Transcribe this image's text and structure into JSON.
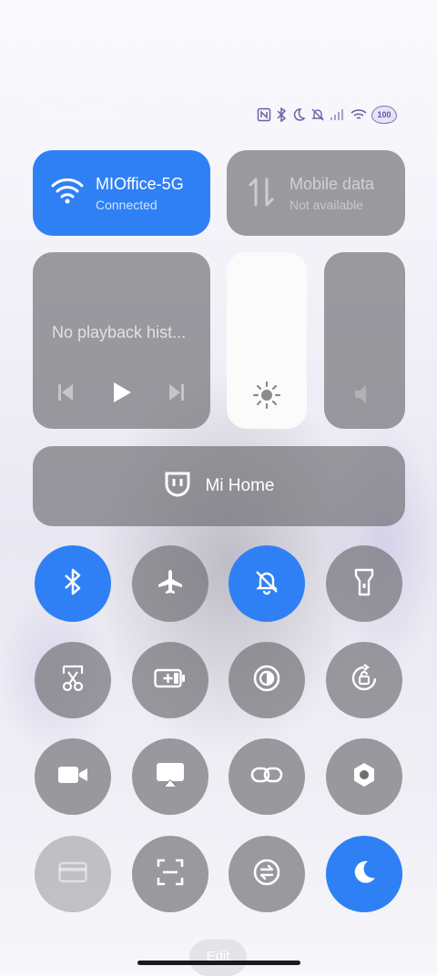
{
  "status_bar": {
    "date": "Thu, Jun 8",
    "battery_level": "100",
    "icons": [
      "nfc-icon",
      "bluetooth-icon",
      "do-not-disturb-moon-icon",
      "silent-bell-icon",
      "signal-icon",
      "wifi-icon",
      "battery-icon"
    ]
  },
  "wifi_tile": {
    "title": "MIOffice-5G",
    "subtitle": "Connected",
    "active": true,
    "color": "#2f80f5"
  },
  "mobile_tile": {
    "title": "Mobile data",
    "subtitle": "Not available",
    "active": false
  },
  "media": {
    "text": "No playback hist..."
  },
  "brightness": {
    "level": 1.0
  },
  "mi_home": {
    "label": "Mi Home"
  },
  "toggles": [
    {
      "name": "bluetooth",
      "icon": "bluetooth-icon",
      "active": true
    },
    {
      "name": "airplane-mode",
      "icon": "airplane-icon",
      "active": false
    },
    {
      "name": "silent",
      "icon": "bell-off-icon",
      "active": true
    },
    {
      "name": "flashlight",
      "icon": "flashlight-icon",
      "active": false
    },
    {
      "name": "screenshot",
      "icon": "scissors-icon",
      "active": false
    },
    {
      "name": "battery-saver",
      "icon": "battery-plus-icon",
      "active": false
    },
    {
      "name": "reading-mode",
      "icon": "contrast-icon",
      "active": false
    },
    {
      "name": "lock-rotation",
      "icon": "rotation-lock-icon",
      "active": false
    },
    {
      "name": "screen-recorder",
      "icon": "video-camera-icon",
      "active": false
    },
    {
      "name": "cast",
      "icon": "cast-icon",
      "active": false
    },
    {
      "name": "link",
      "icon": "link-icon",
      "active": false
    },
    {
      "name": "settings",
      "icon": "hexagon-settings-icon",
      "active": false
    },
    {
      "name": "card",
      "icon": "card-icon",
      "active": false
    },
    {
      "name": "scanner",
      "icon": "scan-icon",
      "active": false
    },
    {
      "name": "sync",
      "icon": "sync-icon",
      "active": false
    },
    {
      "name": "dark-mode",
      "icon": "moon-icon",
      "active": true
    }
  ],
  "edit": {
    "label": "Edit"
  }
}
